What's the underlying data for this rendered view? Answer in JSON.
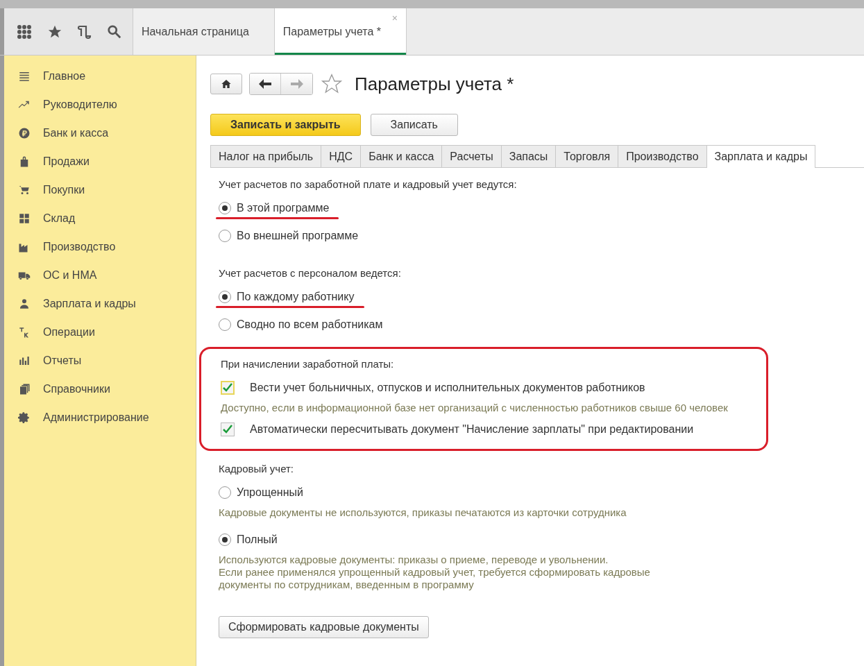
{
  "top_bar": {
    "tabs": [
      {
        "label": "Начальная страница",
        "selected": false
      },
      {
        "label": "Параметры учета *",
        "selected": true,
        "closable": true,
        "close": "×"
      }
    ]
  },
  "sidebar": {
    "items": [
      {
        "label": "Главное"
      },
      {
        "label": "Руководителю"
      },
      {
        "label": "Банк и касса"
      },
      {
        "label": "Продажи"
      },
      {
        "label": "Покупки"
      },
      {
        "label": "Склад"
      },
      {
        "label": "Производство"
      },
      {
        "label": "ОС и НМА"
      },
      {
        "label": "Зарплата и кадры"
      },
      {
        "label": "Операции"
      },
      {
        "label": "Отчеты"
      },
      {
        "label": "Справочники"
      },
      {
        "label": "Администрирование"
      }
    ]
  },
  "form": {
    "title": "Параметры учета *",
    "favorite": false,
    "buttons": [
      {
        "label": "Записать и закрыть",
        "kind": "primary"
      },
      {
        "label": "Записать",
        "kind": "default"
      }
    ],
    "tabs": [
      {
        "label": "Налог на прибыль",
        "selected": false
      },
      {
        "label": "НДС",
        "selected": false
      },
      {
        "label": "Банк и касса",
        "selected": false
      },
      {
        "label": "Расчеты",
        "selected": false
      },
      {
        "label": "Запасы",
        "selected": false
      },
      {
        "label": "Торговля",
        "selected": false
      },
      {
        "label": "Производство",
        "selected": false
      },
      {
        "label": "Зарплата и кадры",
        "selected": true
      }
    ],
    "sections": [
      {
        "kind": "radio_group",
        "label": "Учет расчетов по заработной плате и кадровый учет ведутся:",
        "options": [
          {
            "label": "В этой программе",
            "selected": true,
            "underlined": true
          },
          {
            "label": "Во внешней программе",
            "selected": false
          }
        ]
      },
      {
        "kind": "radio_group",
        "label": "Учет расчетов с персоналом ведется:",
        "options": [
          {
            "label": "По каждому работнику",
            "selected": true,
            "underlined": true
          },
          {
            "label": "Сводно по всем работникам",
            "selected": false
          }
        ]
      },
      {
        "kind": "checkbox_group",
        "label": "При начислении заработной платы:",
        "highlighted": true,
        "items": [
          {
            "label": "Вести учет больничных, отпусков и исполнительных документов работников",
            "checked": true,
            "focused": true,
            "hint": "Доступно, если в информационной базе нет организаций с численностью работников свыше 60 человек"
          },
          {
            "label": "Автоматически пересчитывать документ \"Начисление зарплаты\" при редактировании",
            "checked": true
          }
        ]
      },
      {
        "kind": "radio_group",
        "label": "Кадровый учет:",
        "options": [
          {
            "label": "Упрощенный",
            "selected": false,
            "hint": "Кадровые документы не используются, приказы печатаются из карточки сотрудника"
          },
          {
            "label": "Полный",
            "selected": true,
            "hint": "Используются кадровые документы: приказы о приеме, переводе и увольнении.\nЕсли ранее применялся упрощенный кадровый учет, требуется сформировать кадровые\nдокументы по сотрудникам, введенным в программу"
          }
        ]
      },
      {
        "kind": "action",
        "label": "Сформировать кадровые документы"
      }
    ]
  }
}
